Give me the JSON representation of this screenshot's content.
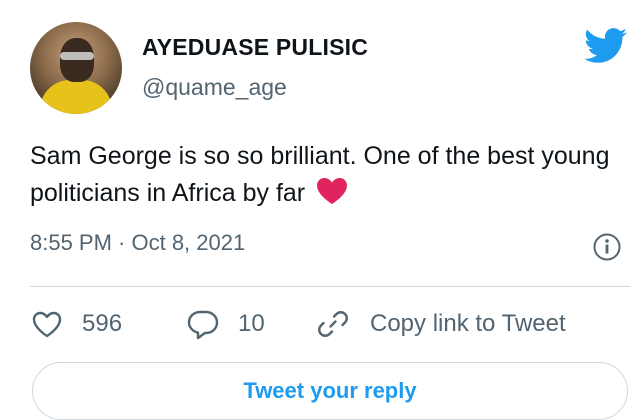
{
  "user": {
    "display_name": "AYEDUASE PULISIC",
    "handle": "@quame_age"
  },
  "tweet": {
    "text": "Sam George is so so brilliant. One of the best young politicians in Africa by far",
    "emoji": "red-heart",
    "timestamp": "8:55 PM · Oct 8, 2021"
  },
  "actions": {
    "likes": "596",
    "replies": "10",
    "copy_link_label": "Copy link to Tweet"
  },
  "reply_button_label": "Tweet your reply",
  "colors": {
    "brand": "#1d9bf0",
    "heart": "#e0245e",
    "muted": "#536471"
  }
}
